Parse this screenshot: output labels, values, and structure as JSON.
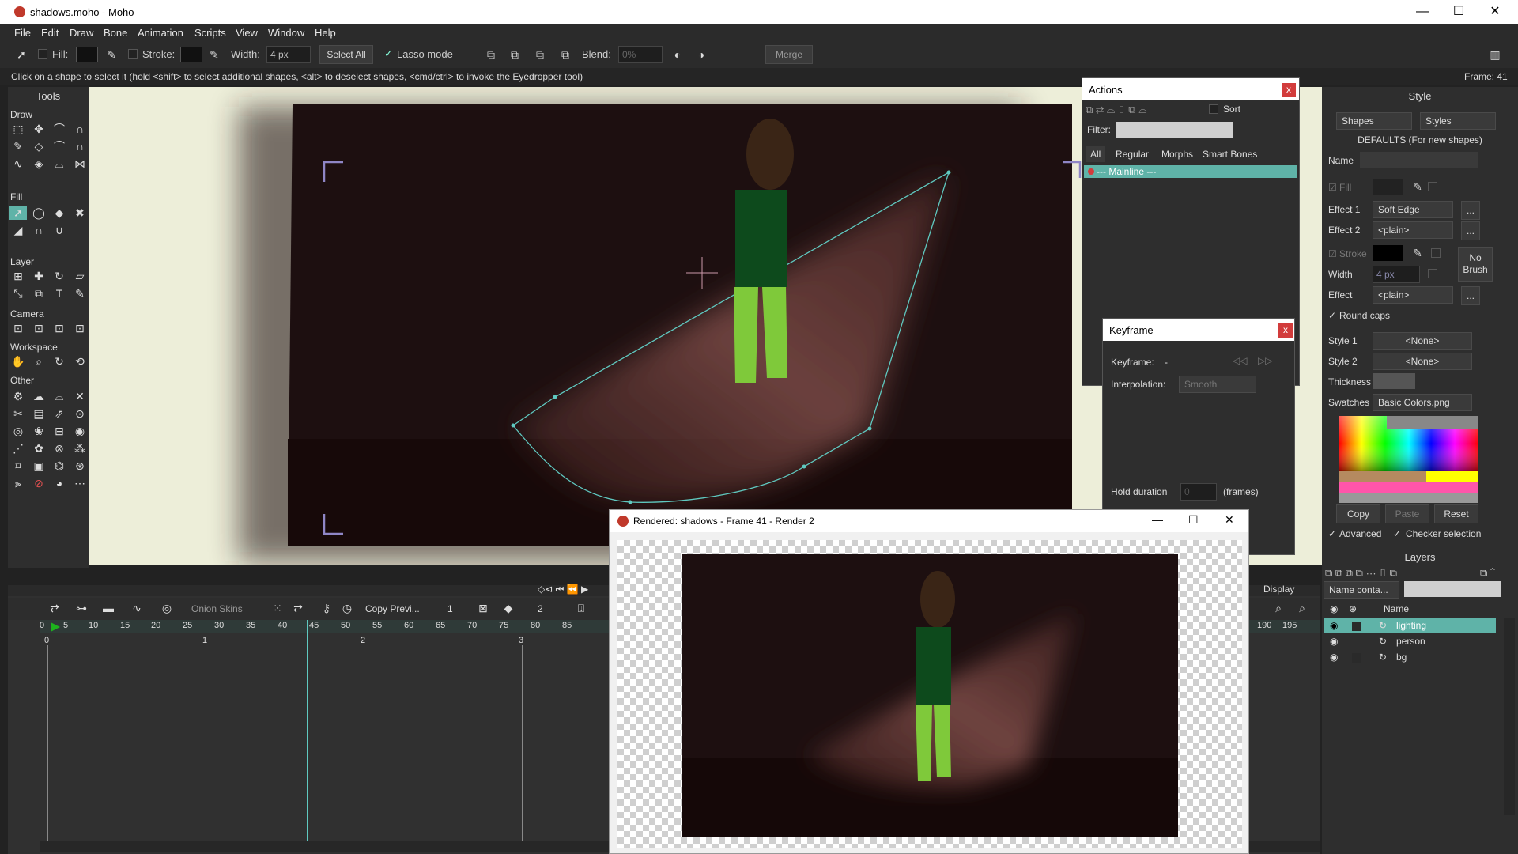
{
  "window": {
    "title": "shadows.moho - Moho",
    "minimize": "—",
    "maximize": "☐",
    "close": "✕"
  },
  "menu": [
    "File",
    "Edit",
    "Draw",
    "Bone",
    "Animation",
    "Scripts",
    "View",
    "Window",
    "Help"
  ],
  "toolbar": {
    "fill_label": "Fill:",
    "stroke_label": "Stroke:",
    "width_label": "Width:",
    "width_value": "4 px",
    "select_all": "Select All",
    "lasso_mode": "Lasso mode",
    "blend_label": "Blend:",
    "blend_value": "0%",
    "merge": "Merge"
  },
  "hint": "Click on a shape to select it (hold <shift> to select additional shapes, <alt> to deselect shapes, <cmd/ctrl> to invoke the Eyedropper tool)",
  "frame_label": "Frame: 41",
  "tools": {
    "title": "Tools",
    "sections": [
      "Draw",
      "Fill",
      "Layer",
      "Camera",
      "Workspace",
      "Other"
    ]
  },
  "actions": {
    "title": "Actions",
    "sort": "Sort",
    "filter_label": "Filter:",
    "tabs": [
      "All",
      "Regular",
      "Morphs",
      "Smart Bones"
    ],
    "items": [
      "--- Mainline ---"
    ]
  },
  "keyframe": {
    "title": "Keyframe",
    "keyframe_label": "Keyframe:",
    "keyframe_value": "-",
    "interp_label": "Interpolation:",
    "interp_value": "Smooth",
    "hold_label": "Hold duration",
    "hold_value": "0",
    "hold_unit": "(frames)"
  },
  "style": {
    "title": "Style",
    "shapes": "Shapes",
    "styles": "Styles",
    "defaults": "DEFAULTS (For new shapes)",
    "name_label": "Name",
    "fill_label": "Fill",
    "effect1_label": "Effect 1",
    "effect1": "Soft Edge",
    "effect2_label": "Effect 2",
    "effect2": "<plain>",
    "stroke_label": "Stroke",
    "width_label": "Width",
    "width_value": "4 px",
    "effect_label": "Effect",
    "effect": "<plain>",
    "no_brush": "No Brush",
    "round_caps": "Round caps",
    "style1_label": "Style 1",
    "style1": "<None>",
    "style2_label": "Style 2",
    "style2": "<None>",
    "thickness_label": "Thickness",
    "swatches_label": "Swatches",
    "swatches": "Basic Colors.png",
    "copy": "Copy",
    "paste": "Paste",
    "reset": "Reset",
    "advanced": "Advanced",
    "checker": "Checker selection",
    "ellipsis": "..."
  },
  "layers": {
    "title": "Layers",
    "filter": "Name conta...",
    "name_col": "Name",
    "items": [
      "lighting",
      "person",
      "bg"
    ]
  },
  "timeline": {
    "onion": "Onion Skins",
    "copy_prev": "Copy Previ...",
    "one": "1",
    "two": "2",
    "display": "Display",
    "ruler": [
      "0",
      "5",
      "10",
      "15",
      "20",
      "25",
      "30",
      "35",
      "40",
      "45",
      "50",
      "55",
      "60",
      "65",
      "70",
      "75",
      "80",
      "85"
    ],
    "ruler_end": [
      "190",
      "195"
    ],
    "seconds": [
      "0",
      "1",
      "2",
      "3"
    ]
  },
  "render": {
    "title": "Rendered: shadows - Frame 41 - Render 2"
  },
  "colors": {
    "accent": "#5fb3a8",
    "close": "#d23c3c",
    "bg": "#2e2e2e"
  }
}
